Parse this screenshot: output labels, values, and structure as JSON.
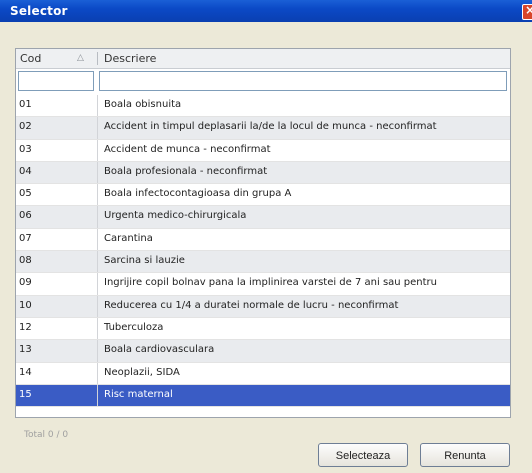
{
  "window": {
    "title": "Selector"
  },
  "grid": {
    "columns": [
      "Cod",
      "Descriere"
    ],
    "rows": [
      {
        "cod": "01",
        "descriere": "Boala obisnuita"
      },
      {
        "cod": "02",
        "descriere": "Accident in timpul deplasarii la/de la locul de munca - neconfirmat"
      },
      {
        "cod": "03",
        "descriere": "Accident de munca - neconfirmat"
      },
      {
        "cod": "04",
        "descriere": "Boala profesionala - neconfirmat"
      },
      {
        "cod": "05",
        "descriere": "Boala infectocontagioasa din grupa A"
      },
      {
        "cod": "06",
        "descriere": "Urgenta medico-chirurgicala"
      },
      {
        "cod": "07",
        "descriere": "Carantina"
      },
      {
        "cod": "08",
        "descriere": "Sarcina si lauzie"
      },
      {
        "cod": "09",
        "descriere": "Ingrijire copil bolnav pana la implinirea varstei de 7 ani sau pentru"
      },
      {
        "cod": "10",
        "descriere": "Reducerea cu 1/4 a duratei normale de lucru - neconfirmat"
      },
      {
        "cod": "12",
        "descriere": "Tuberculoza"
      },
      {
        "cod": "13",
        "descriere": "Boala cardiovasculara"
      },
      {
        "cod": "14",
        "descriere": "Neoplazii, SIDA"
      },
      {
        "cod": "15",
        "descriere": "Risc maternal"
      }
    ],
    "selected_index": 13
  },
  "status": {
    "text": "Total 0 / 0"
  },
  "buttons": {
    "select": "Selecteaza",
    "cancel": "Renunta"
  }
}
